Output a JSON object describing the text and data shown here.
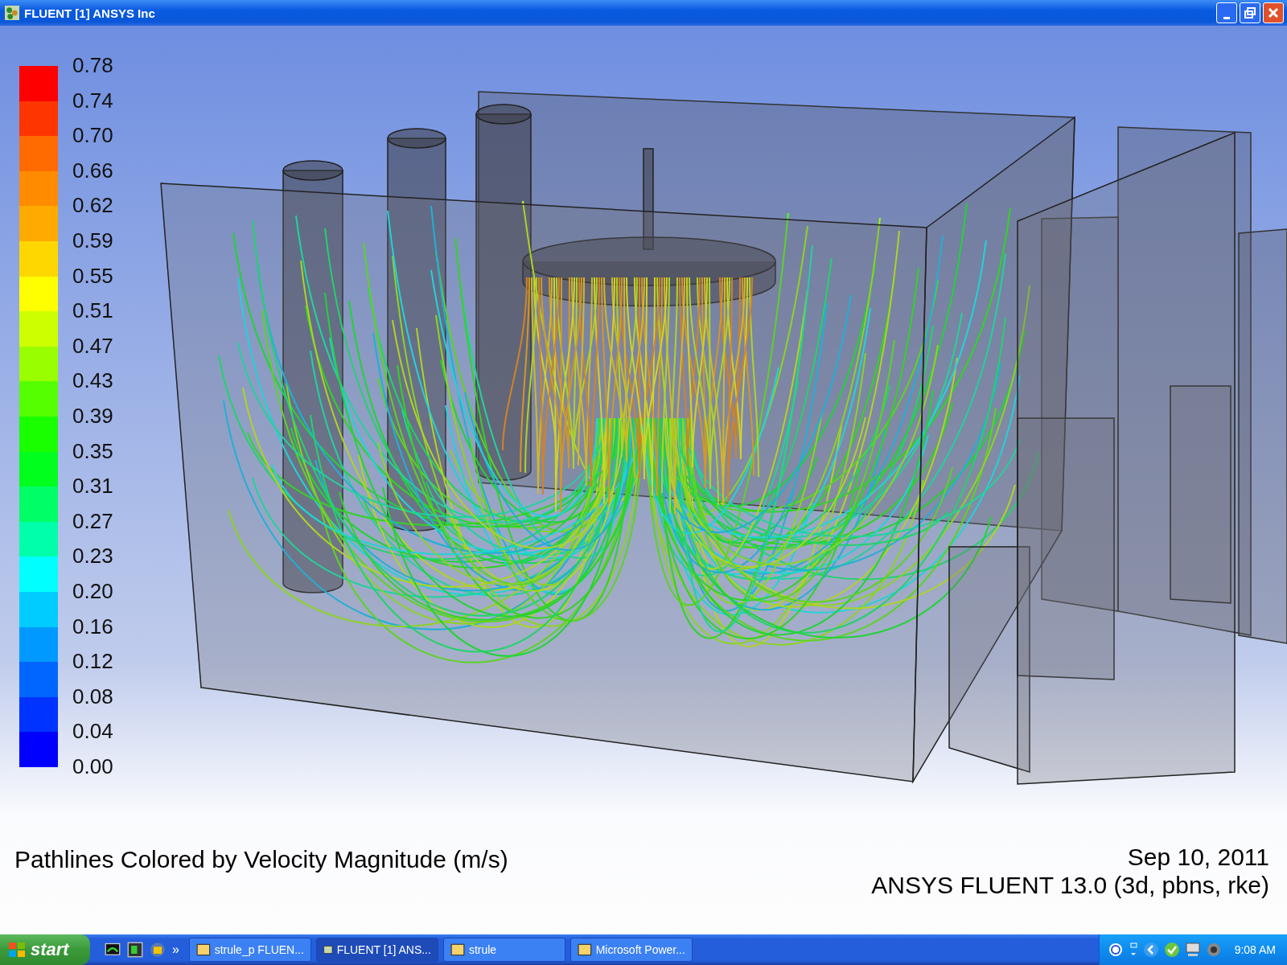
{
  "window": {
    "title": "FLUENT [1] ANSYS Inc"
  },
  "legend": {
    "labels": [
      "0.78",
      "0.74",
      "0.70",
      "0.66",
      "0.62",
      "0.59",
      "0.55",
      "0.51",
      "0.47",
      "0.43",
      "0.39",
      "0.35",
      "0.31",
      "0.27",
      "0.23",
      "0.20",
      "0.16",
      "0.12",
      "0.08",
      "0.04",
      "0.00"
    ],
    "bands": [
      {
        "color": "#ff0000"
      },
      {
        "color": "#ff3500"
      },
      {
        "color": "#ff6b00"
      },
      {
        "color": "#ff8c00"
      },
      {
        "color": "#ffaa00"
      },
      {
        "color": "#ffd700"
      },
      {
        "color": "#ffff00"
      },
      {
        "color": "#ccff00"
      },
      {
        "color": "#99ff00"
      },
      {
        "color": "#55ff00"
      },
      {
        "color": "#19ff00"
      },
      {
        "color": "#00ff1c"
      },
      {
        "color": "#00ff66"
      },
      {
        "color": "#00ffaa"
      },
      {
        "color": "#00ffff"
      },
      {
        "color": "#00ccff"
      },
      {
        "color": "#0099ff"
      },
      {
        "color": "#0066ff"
      },
      {
        "color": "#0033ff"
      },
      {
        "color": "#0000ff"
      }
    ]
  },
  "caption": {
    "title": "Pathlines Colored by Velocity Magnitude (m/s)",
    "date": "Sep 10, 2011",
    "version": "ANSYS FLUENT 13.0 (3d, pbns, rke)"
  },
  "taskbar": {
    "start": "start",
    "chevron": "»",
    "tasks": [
      {
        "label": "strule_p FLUEN...",
        "selected": false
      },
      {
        "label": "FLUENT [1] ANS...",
        "selected": true
      },
      {
        "label": "strule",
        "selected": false
      },
      {
        "label": "Microsoft Power...",
        "selected": false
      }
    ],
    "clock": "9:08 AM"
  }
}
